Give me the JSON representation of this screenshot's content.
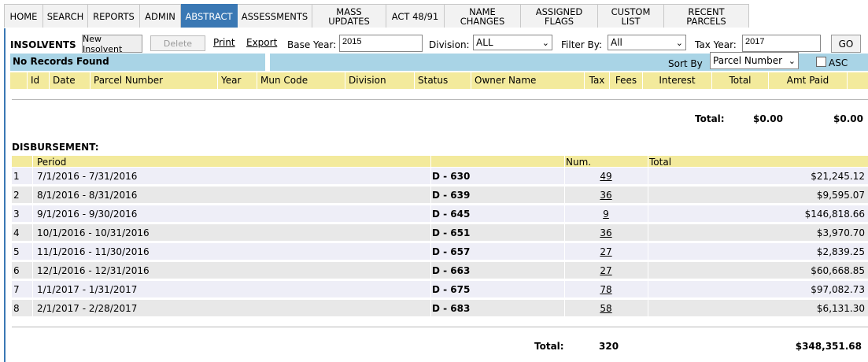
{
  "nav": {
    "tabs": [
      {
        "label": "HOME",
        "w": 50
      },
      {
        "label": "SEARCH",
        "w": 57
      },
      {
        "label": "REPORTS",
        "w": 66
      },
      {
        "label": "ADMIN",
        "w": 52
      },
      {
        "label": "ABSTRACT",
        "w": 72
      },
      {
        "label": "ASSESSMENTS",
        "w": 95
      },
      {
        "label": "MASS UPDATES",
        "w": 94
      },
      {
        "label": "ACT 48/91",
        "w": 74
      },
      {
        "label": "NAME CHANGES",
        "w": 97
      },
      {
        "label": "ASSIGNED FLAGS",
        "w": 98
      },
      {
        "label": "CUSTOM LIST",
        "w": 84
      },
      {
        "label": "RECENT PARCELS",
        "w": 108
      }
    ]
  },
  "toolbar": {
    "section_title": "INSOLVENTS",
    "new_label": "New Insolvent",
    "delete_label": "Delete",
    "print_label": "Print",
    "export_label": "Export",
    "base_year_label": "Base Year:",
    "base_year_value": "2015",
    "division_label": "Division:",
    "division_value": "ALL",
    "filter_label": "Filter By:",
    "filter_value": "All",
    "tax_year_label": "Tax Year:",
    "tax_year_value": "2017",
    "go_label": "GO"
  },
  "status": {
    "message": "No Records Found",
    "sort_label": "Sort By",
    "sort_value": "Parcel Number",
    "asc_label": "ASC"
  },
  "insolvent_table": {
    "columns": [
      "Id",
      "Date",
      "Parcel Number",
      "Year",
      "Mun Code",
      "Division",
      "Status",
      "Owner Name",
      "Tax",
      "Fees",
      "Interest",
      "Total",
      "Amt Paid"
    ],
    "total_label": "Total:",
    "total_value": "$0.00",
    "amt_paid_total": "$0.00"
  },
  "disbursement": {
    "title": "DISBURSEMENT:",
    "columns": {
      "period": "Period",
      "num": "Num.",
      "total": "Total"
    },
    "rows": [
      {
        "n": "1",
        "period": "7/1/2016  -  7/31/2016",
        "code": "D - 630",
        "num": "49",
        "total": "$21,245.12"
      },
      {
        "n": "2",
        "period": "8/1/2016  -  8/31/2016",
        "code": "D - 639",
        "num": "36",
        "total": "$9,595.07"
      },
      {
        "n": "3",
        "period": "9/1/2016  -  9/30/2016",
        "code": "D - 645",
        "num": "9",
        "total": "$146,818.66"
      },
      {
        "n": "4",
        "period": "10/1/2016  -  10/31/2016",
        "code": "D - 651",
        "num": "36",
        "total": "$3,970.70"
      },
      {
        "n": "5",
        "period": "11/1/2016  -  11/30/2016",
        "code": "D - 657",
        "num": "27",
        "total": "$2,839.25"
      },
      {
        "n": "6",
        "period": "12/1/2016  -  12/31/2016",
        "code": "D - 663",
        "num": "27",
        "total": "$60,668.85"
      },
      {
        "n": "7",
        "period": "1/1/2017  -  1/31/2017",
        "code": "D - 675",
        "num": "78",
        "total": "$97,082.73"
      },
      {
        "n": "8",
        "period": "2/1/2017  -  2/28/2017",
        "code": "D - 683",
        "num": "58",
        "total": "$6,131.30"
      }
    ],
    "total_label": "Total:",
    "total_num": "320",
    "total_amount": "$348,351.68"
  },
  "colors": {
    "accent": "#3a78b4",
    "header_yellow": "#f3ea9c",
    "status_blue": "#a9d4e6",
    "highlight_red": "#d32a2a"
  }
}
